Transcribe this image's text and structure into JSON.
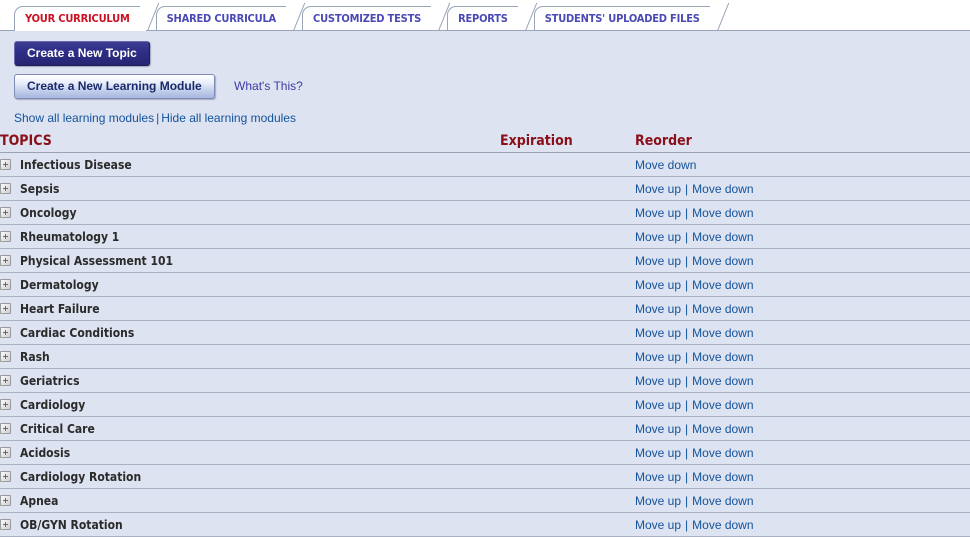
{
  "tabs": [
    {
      "label": "YOUR CURRICULUM",
      "active": true,
      "name": "tab-your-curriculum"
    },
    {
      "label": "SHARED CURRICULA",
      "active": false,
      "name": "tab-shared-curricula"
    },
    {
      "label": "CUSTOMIZED TESTS",
      "active": false,
      "name": "tab-customized-tests"
    },
    {
      "label": "REPORTS",
      "active": false,
      "name": "tab-reports"
    },
    {
      "label": "STUDENTS' UPLOADED FILES",
      "active": false,
      "name": "tab-students-uploaded-files"
    }
  ],
  "toolbar": {
    "create_topic_label": "Create a New Topic",
    "create_module_label": "Create a New Learning Module",
    "whats_this_label": "What's This?"
  },
  "toggle_links": {
    "show_all_label": "Show all learning modules",
    "separator": "|",
    "hide_all_label": "Hide all learning modules"
  },
  "table": {
    "headers": {
      "topics": "TOPICS",
      "expiration": "Expiration",
      "reorder": "Reorder"
    },
    "move_up_label": "Move up",
    "move_down_label": "Move down",
    "pipe": "|",
    "rows": [
      {
        "name": "Infectious Disease",
        "expiration": "",
        "move_up": false,
        "move_down": true
      },
      {
        "name": "Sepsis",
        "expiration": "",
        "move_up": true,
        "move_down": true
      },
      {
        "name": "Oncology",
        "expiration": "",
        "move_up": true,
        "move_down": true
      },
      {
        "name": "Rheumatology 1",
        "expiration": "",
        "move_up": true,
        "move_down": true
      },
      {
        "name": "Physical Assessment 101",
        "expiration": "",
        "move_up": true,
        "move_down": true
      },
      {
        "name": "Dermatology",
        "expiration": "",
        "move_up": true,
        "move_down": true
      },
      {
        "name": "Heart Failure",
        "expiration": "",
        "move_up": true,
        "move_down": true
      },
      {
        "name": "Cardiac Conditions",
        "expiration": "",
        "move_up": true,
        "move_down": true
      },
      {
        "name": "Rash",
        "expiration": "",
        "move_up": true,
        "move_down": true
      },
      {
        "name": "Geriatrics",
        "expiration": "",
        "move_up": true,
        "move_down": true
      },
      {
        "name": "Cardiology",
        "expiration": "",
        "move_up": true,
        "move_down": true
      },
      {
        "name": "Critical Care",
        "expiration": "",
        "move_up": true,
        "move_down": true
      },
      {
        "name": "Acidosis",
        "expiration": "",
        "move_up": true,
        "move_down": true
      },
      {
        "name": "Cardiology Rotation",
        "expiration": "",
        "move_up": true,
        "move_down": true
      },
      {
        "name": "Apnea",
        "expiration": "",
        "move_up": true,
        "move_down": true
      },
      {
        "name": "OB/GYN Rotation",
        "expiration": "",
        "move_up": true,
        "move_down": true
      }
    ]
  },
  "colors": {
    "page_background": "#dde3f0",
    "active_tab_text": "#cc1122",
    "inactive_tab_text": "#4a49b5",
    "header_text": "#8b0f18",
    "link_text": "#14529c",
    "row_border": "#a8b0c2"
  }
}
